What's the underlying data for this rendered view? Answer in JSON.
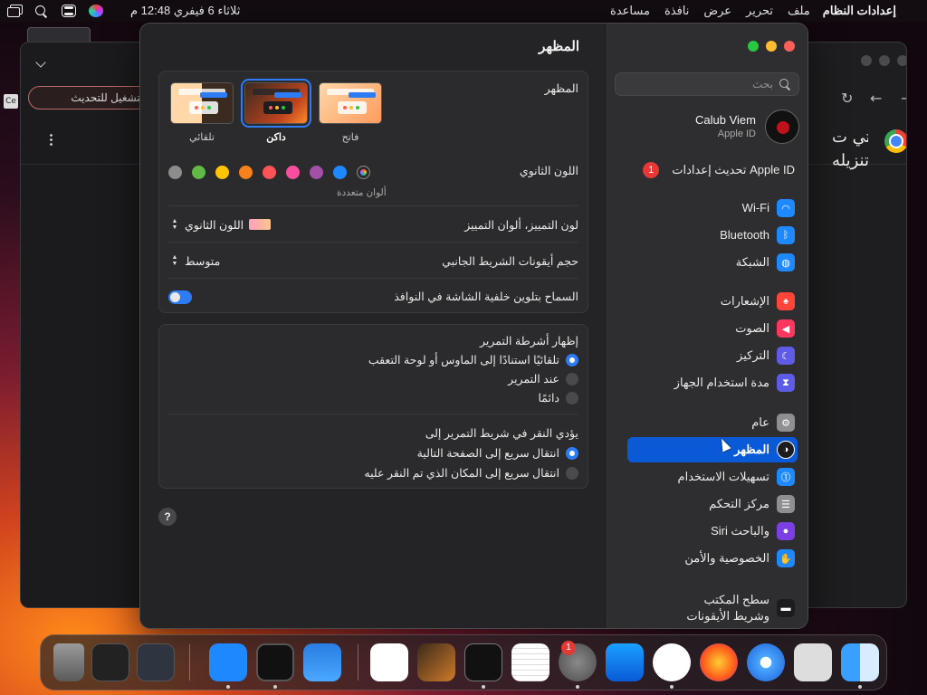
{
  "menubar": {
    "app_name": "إعدادات النظام",
    "items": [
      "ملف",
      "تحرير",
      "عرض",
      "نافذة",
      "مساعدة"
    ],
    "clock": "ثلاثاء 6 فيفري  12:48 م"
  },
  "browser_bg": {
    "relaunch_label": "التشغيل للتحديث",
    "partial_text": [
      "التي ت",
      "تنزيله"
    ],
    "partial_tab_text": "Ce"
  },
  "sidebar": {
    "search_placeholder": "بحث",
    "user_name": "Calub Viem",
    "user_sub": "Apple ID",
    "update_label": "تحديث إعدادات Apple ID",
    "update_badge": "1",
    "items": [
      {
        "label": "Wi-Fi",
        "icon": "wifi-icon",
        "color": "#1e88ff"
      },
      {
        "label": "Bluetooth",
        "icon": "bluetooth-icon",
        "color": "#1e88ff"
      },
      {
        "label": "الشبكة",
        "icon": "globe-icon",
        "color": "#1e88ff"
      },
      {
        "label": "الإشعارات",
        "icon": "bell-icon",
        "color": "#ff453a"
      },
      {
        "label": "الصوت",
        "icon": "speaker-icon",
        "color": "#ff375f"
      },
      {
        "label": "التركيز",
        "icon": "moon-icon",
        "color": "#5e5ce6"
      },
      {
        "label": "مدة استخدام الجهاز",
        "icon": "hourglass-icon",
        "color": "#5e5ce6"
      },
      {
        "label": "عام",
        "icon": "gear-icon",
        "color": "#8e8e93"
      },
      {
        "label": "المظهر",
        "icon": "appearance-icon",
        "color": "#1c1c1e"
      },
      {
        "label": "تسهيلات الاستخدام",
        "icon": "accessibility-icon",
        "color": "#1e88ff"
      },
      {
        "label": "مركز التحكم",
        "icon": "control-center-icon",
        "color": "#8e8e93"
      },
      {
        "label": "Siri والباحث",
        "icon": "siri-icon",
        "color": "#7b3fe4"
      },
      {
        "label": "الخصوصية والأمن",
        "icon": "hand-icon",
        "color": "#1e88ff"
      },
      {
        "label": "سطح المكتب\nوشريط الأيقونات",
        "icon": "dock-icon",
        "color": "#1c1c1e"
      }
    ]
  },
  "content": {
    "title": "المظهر",
    "appearance_label": "المظهر",
    "themes": [
      "فاتح",
      "داكن",
      "تلقائي"
    ],
    "selected_theme": "داكن",
    "accent_label": "اللون الثانوي",
    "accent_caption": "ألوان متعددة",
    "accent_colors": [
      "#bf5af2",
      "#1e88ff",
      "#a550a7",
      "#f74f9e",
      "#ff5257",
      "#f7821b",
      "#ffc600",
      "#62ba46",
      "#8c8c8c"
    ],
    "highlight_label": "لون التمييز، ألوان التمييز",
    "highlight_value": "اللون الثانوي",
    "sidebar_icon_label": "حجم أيقونات الشريط الجانبي",
    "sidebar_icon_value": "متوسط",
    "tinting_label": "السماح بتلوين خلفية الشاشة في النوافذ",
    "tinting_on": true,
    "scrollbars_label": "إظهار أشرطة التمرير",
    "scrollbar_options": [
      "تلقائيًا استنادًا إلى الماوس أو لوحة التعقب",
      "عند التمرير",
      "دائمًا"
    ],
    "scrollbar_selected": 0,
    "click_label": "يؤدي النقر في شريط التمرير إلى",
    "click_options": [
      "انتقال سريع إلى الصفحة التالية",
      "انتقال سريع إلى المكان الذي تم النقر عليه"
    ],
    "click_selected": 0,
    "help": "?"
  },
  "dock": {
    "settings_badge": "1",
    "apps": [
      "Trash",
      "Screenshot",
      "Screenshot",
      "Wireless Diagnostics",
      "Activity Monitor",
      "Weather",
      "Visual Studio Code",
      "GarageBand",
      "Terminal",
      "TextEdit",
      "System Settings",
      "App Store",
      "Google Chrome",
      "Firefox",
      "Safari",
      "Launchpad",
      "Finder"
    ]
  }
}
